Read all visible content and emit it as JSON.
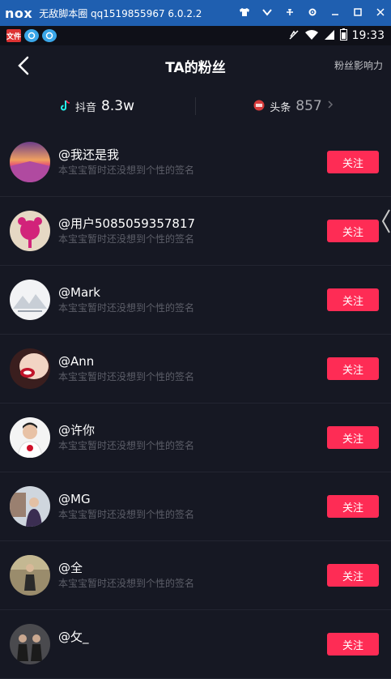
{
  "emulator": {
    "logo": "nox",
    "title": "无敌脚本圈 qq1519855967 6.0.2.2",
    "controls": [
      "shirt-icon",
      "chevron-down-icon",
      "pin-icon",
      "gear-icon",
      "minimize-icon",
      "maximize-icon",
      "close-icon"
    ]
  },
  "status": {
    "notif_label": "文件",
    "time": "19:33"
  },
  "nav": {
    "title": "TA的粉丝",
    "right_link": "粉丝影响力"
  },
  "stats": [
    {
      "name": "抖音",
      "count": "8.3w"
    },
    {
      "name": "头条",
      "count": "857"
    }
  ],
  "followers": [
    {
      "name": "@我还是我",
      "signature": "本宝宝暂时还没想到个性的签名",
      "button": "关注",
      "avatar": "sunset-field"
    },
    {
      "name": "@用户5085059357817",
      "signature": "本宝宝暂时还没想到个性的签名",
      "button": "关注",
      "avatar": "pink-bear"
    },
    {
      "name": "@Mark",
      "signature": "本宝宝暂时还没想到个性的签名",
      "button": "关注",
      "avatar": "mountain-sketch"
    },
    {
      "name": "@Ann",
      "signature": "本宝宝暂时还没想到个性的签名",
      "button": "关注",
      "avatar": "red-lips"
    },
    {
      "name": "@许你",
      "signature": "本宝宝暂时还没想到个性的签名",
      "button": "关注",
      "avatar": "boy-rose"
    },
    {
      "name": "@MG",
      "signature": "本宝宝暂时还没想到个性的签名",
      "button": "关注",
      "avatar": "person-building"
    },
    {
      "name": "@全",
      "signature": "本宝宝暂时还没想到个性的签名",
      "button": "关注",
      "avatar": "person-outdoor"
    },
    {
      "name": "@攵_",
      "signature": "",
      "button": "关注",
      "avatar": "group-photo"
    }
  ],
  "colors": {
    "background": "#161823",
    "accent": "#fe2c55",
    "emulator_bar": "#1f5fb0"
  }
}
